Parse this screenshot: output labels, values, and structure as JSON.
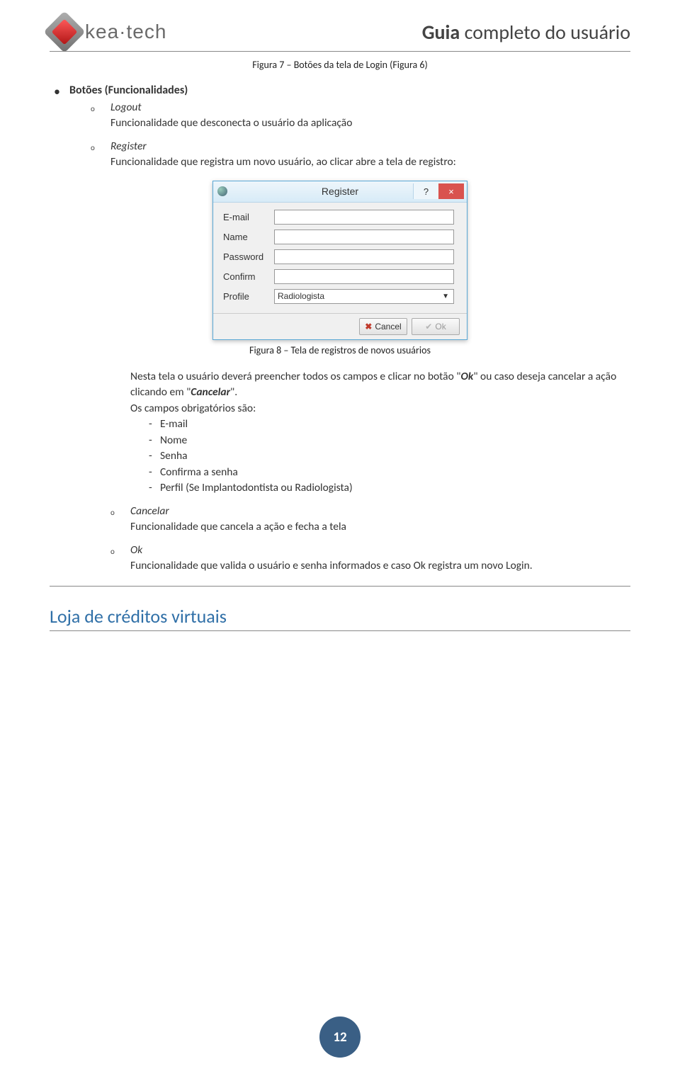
{
  "header": {
    "logo_text": "kea·tech",
    "doc_title_bold": "Guia",
    "doc_title_rest": " completo do usuário"
  },
  "caption_fig7": "Figura 7 – Botões da tela de Login (Figura 6)",
  "bullets_title": "Botões (Funcionalidades)",
  "items": {
    "logout": {
      "head": "Logout",
      "desc": "Funcionalidade que desconecta o usuário da aplicação"
    },
    "register": {
      "head": "Register",
      "desc": "Funcionalidade que registra um novo usuário, ao clicar abre a tela de registro:"
    },
    "cancelar": {
      "head": "Cancelar",
      "desc": "Funcionalidade que cancela a ação e fecha a tela"
    },
    "ok": {
      "head": "Ok",
      "desc": "Funcionalidade que valida o usuário e senha informados e caso Ok registra um novo Login."
    }
  },
  "dialog": {
    "title": "Register",
    "help": "?",
    "close": "×",
    "labels": {
      "email": "E-mail",
      "name": "Name",
      "password": "Password",
      "confirm": "Confirm",
      "profile": "Profile"
    },
    "profile_value": "Radiologista",
    "cancel_btn": "Cancel",
    "ok_btn": "Ok"
  },
  "caption_fig8": "Figura 8 – Tela de registros de novos usuários",
  "para_after_fig8": {
    "p1a": "Nesta tela o usuário deverá preencher todos os campos e clicar no botão \"",
    "p1_ok": "Ok",
    "p1b": "\" ou caso deseja cancelar a ação clicando em \"",
    "p1_cancelar": "Cancelar",
    "p1c": "\".",
    "p2": "Os campos obrigatórios são:"
  },
  "mandatory_fields": {
    "f1": "E-mail",
    "f2": "Nome",
    "f3": "Senha",
    "f4": "Confirma a senha",
    "f5": "Perfil (Se Implantodontista ou Radiologista)"
  },
  "section_title": "Loja de créditos virtuais",
  "page_number": "12"
}
